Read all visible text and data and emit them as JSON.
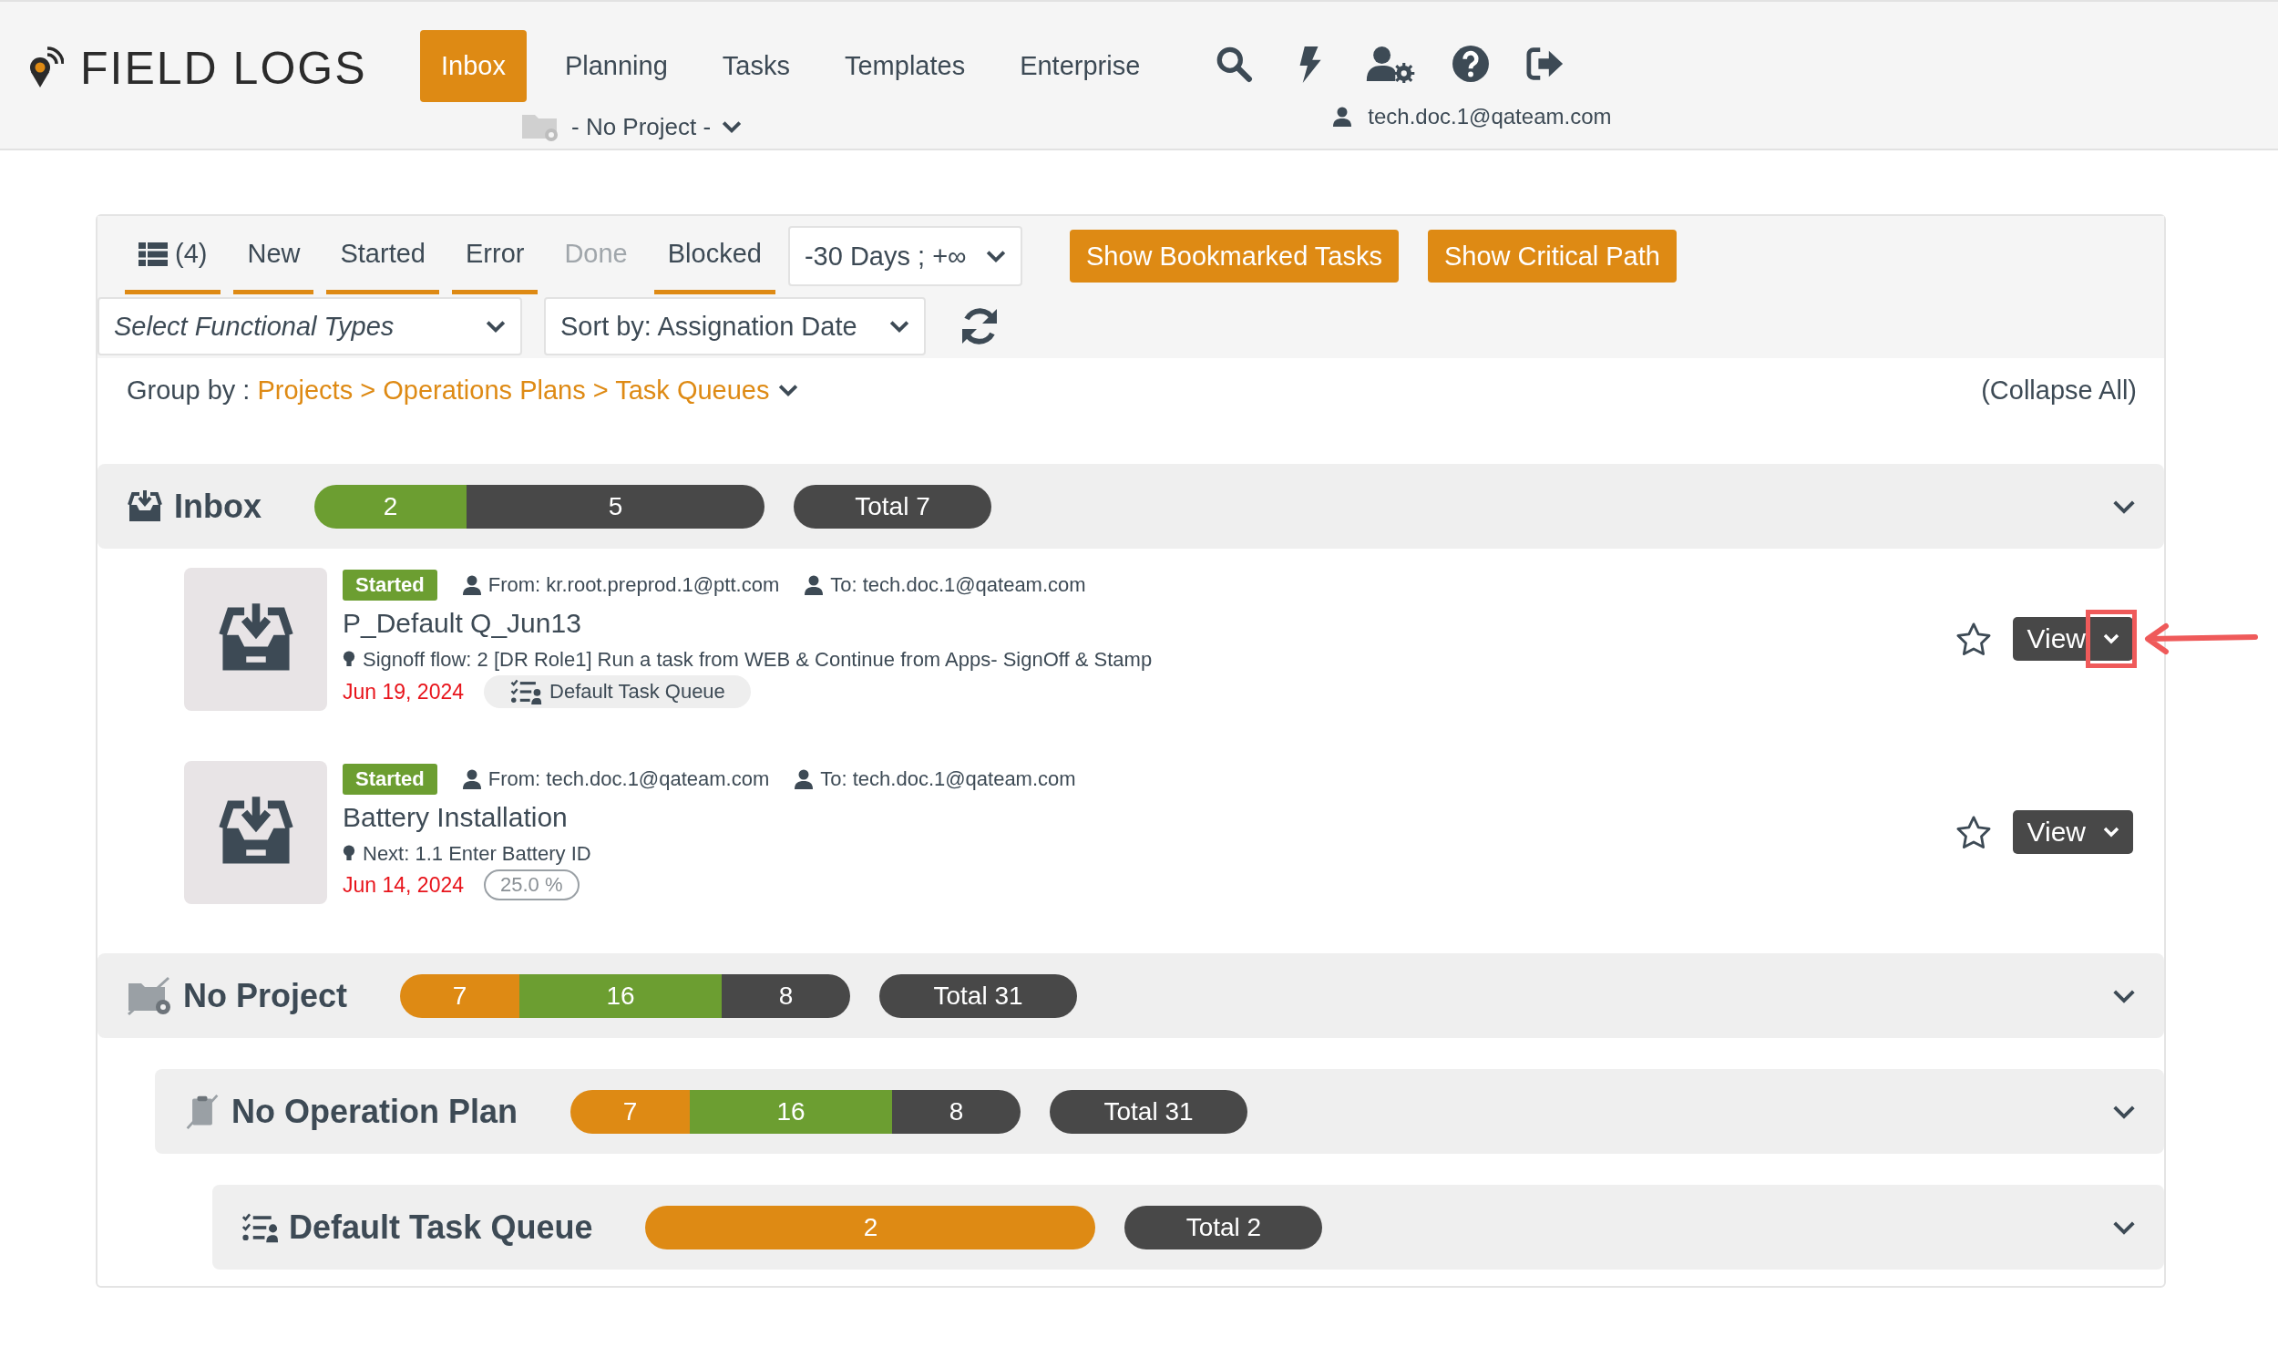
{
  "brand": {
    "name": "FIELD LOGS"
  },
  "nav": [
    {
      "label": "Inbox",
      "selected": true
    },
    {
      "label": "Planning",
      "selected": false
    },
    {
      "label": "Tasks",
      "selected": false
    },
    {
      "label": "Templates",
      "selected": false
    },
    {
      "label": "Enterprise",
      "selected": false
    }
  ],
  "project_selector": {
    "label": "- No Project -"
  },
  "user": {
    "email": "tech.doc.1@qateam.com"
  },
  "status_tabs": [
    {
      "label": "(4)",
      "kind": "list",
      "disabled": false
    },
    {
      "label": "New",
      "kind": "status",
      "disabled": false
    },
    {
      "label": "Started",
      "kind": "status",
      "disabled": false
    },
    {
      "label": "Error",
      "kind": "status",
      "disabled": false
    },
    {
      "label": "Done",
      "kind": "status",
      "disabled": true
    },
    {
      "label": "Blocked",
      "kind": "status",
      "disabled": false
    }
  ],
  "date_filter": {
    "value": "-30 Days ; +∞"
  },
  "action_buttons": [
    "Show Bookmarked Tasks",
    "Show Critical Path"
  ],
  "functional_types": {
    "placeholder": "Select Functional Types"
  },
  "sort": {
    "value": "Sort by: Assignation Date"
  },
  "group_by": {
    "label": "Group by :",
    "path": "Projects > Operations Plans > Task Queues"
  },
  "collapse_all": "(Collapse All)",
  "groups": [
    {
      "title": "Inbox",
      "kind": "inbox",
      "segments": [
        {
          "count": "2",
          "color": "#6c9e31"
        },
        {
          "count": "5",
          "color": "#484848"
        }
      ],
      "total": "Total 7",
      "tasks": [
        {
          "status": "Started",
          "from": "From: kr.root.preprod.1@ptt.com",
          "to": "To: tech.doc.1@qateam.com",
          "title": "P_Default Q_Jun13",
          "info": "Signoff flow: 2 [DR Role1] Run a task from WEB & Continue from Apps- SignOff & Stamp",
          "date": "Jun 19, 2024",
          "tag": {
            "kind": "queue",
            "label": "Default Task Queue"
          },
          "bookmarked": false,
          "button": "View",
          "highlighted": true
        },
        {
          "status": "Started",
          "from": "From: tech.doc.1@qateam.com",
          "to": "To: tech.doc.1@qateam.com",
          "title": "Battery Installation",
          "info": "Next: 1.1 Enter Battery ID",
          "date": "Jun 14, 2024",
          "tag": {
            "kind": "progress",
            "label": "25.0 %"
          },
          "bookmarked": false,
          "button": "View",
          "highlighted": false
        }
      ]
    },
    {
      "title": "No Project",
      "kind": "project",
      "segments": [
        {
          "count": "7",
          "color": "#de8a14"
        },
        {
          "count": "16",
          "color": "#6c9e31"
        },
        {
          "count": "8",
          "color": "#484848"
        }
      ],
      "total": "Total 31",
      "children": [
        {
          "title": "No Operation Plan",
          "kind": "plan",
          "segments": [
            {
              "count": "7",
              "color": "#de8a14"
            },
            {
              "count": "16",
              "color": "#6c9e31"
            },
            {
              "count": "8",
              "color": "#484848"
            }
          ],
          "total": "Total 31",
          "children": [
            {
              "title": "Default Task Queue",
              "kind": "queue",
              "segments": [
                {
                  "count": "2",
                  "color": "#de8a14"
                }
              ],
              "total": "Total 2"
            }
          ]
        }
      ]
    }
  ]
}
